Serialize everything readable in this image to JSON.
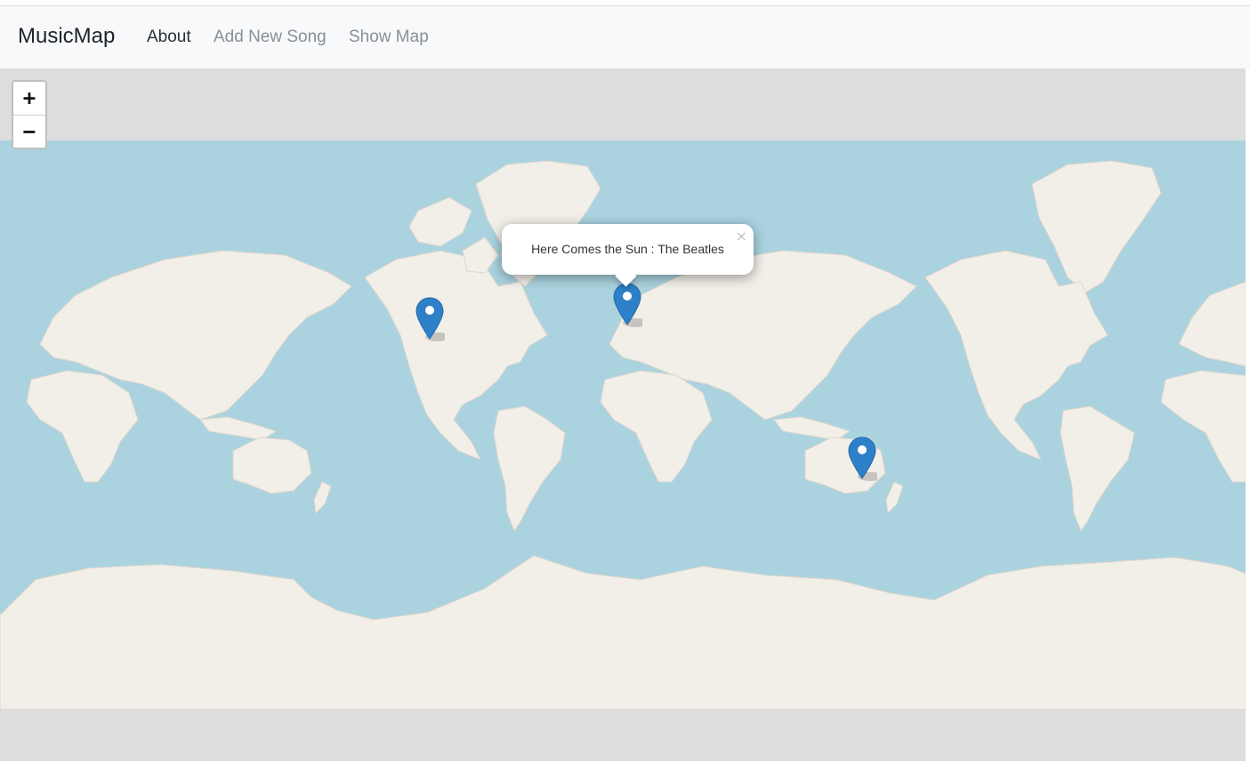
{
  "navbar": {
    "brand": "MusicMap",
    "links": [
      {
        "label": "About",
        "active": true
      },
      {
        "label": "Add New Song",
        "active": false
      },
      {
        "label": "Show Map",
        "active": false
      }
    ]
  },
  "map": {
    "zoom_in": "+",
    "zoom_out": "−",
    "popup": {
      "text": "Here Comes the Sun : The Beatles",
      "close": "×"
    },
    "markers": [
      {
        "name": "marker-north-america",
        "icon": "map-pin-icon"
      },
      {
        "name": "marker-europe",
        "icon": "map-pin-icon"
      },
      {
        "name": "marker-australia",
        "icon": "map-pin-icon"
      }
    ],
    "colors": {
      "water": "#aad3df",
      "land": "#f2efe9",
      "empty": "#dddddd",
      "marker": "#2e81c8"
    }
  }
}
